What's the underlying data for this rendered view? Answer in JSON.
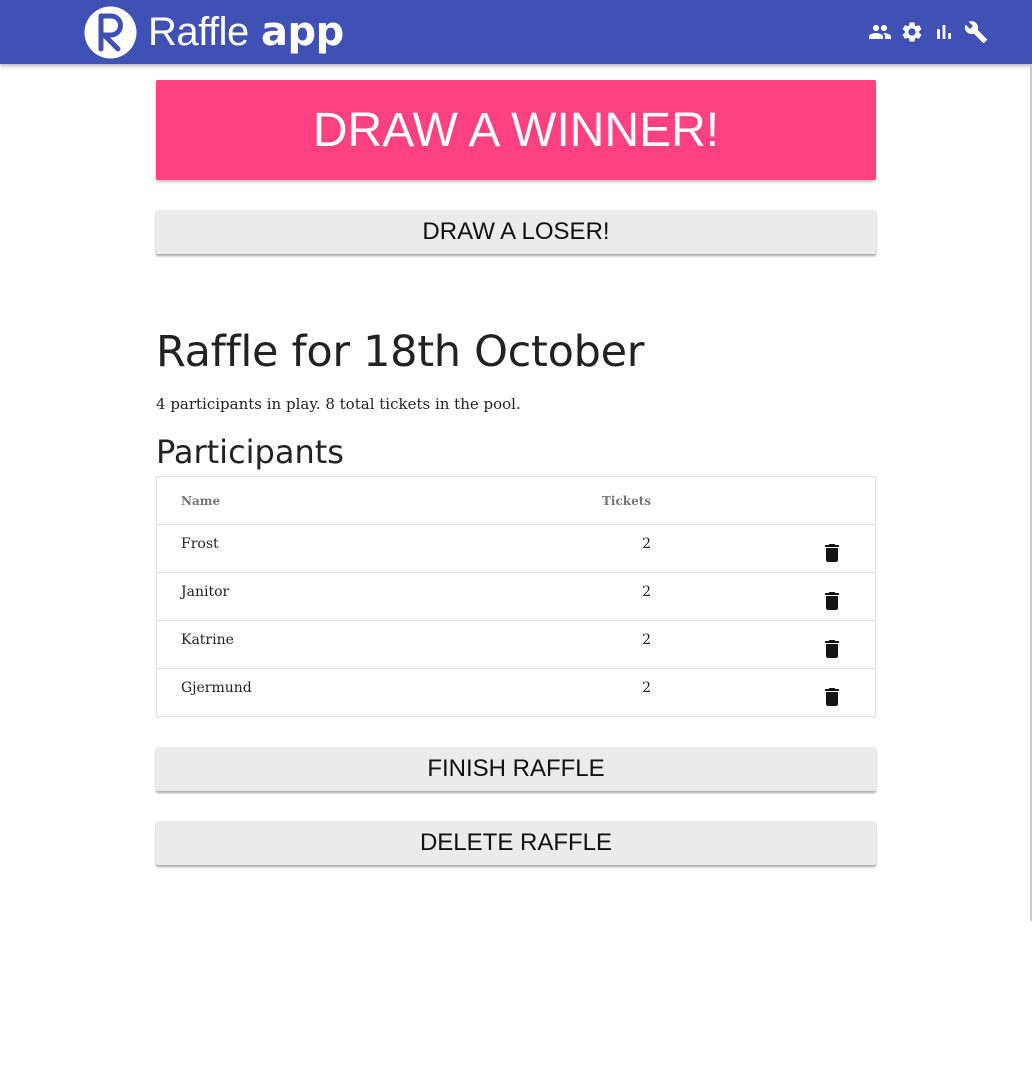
{
  "app": {
    "logo_light": "Raffle",
    "logo_bold": "app",
    "actions": [
      {
        "icon": "people-icon",
        "label": "Participants"
      },
      {
        "icon": "gear-icon",
        "label": "Settings"
      },
      {
        "icon": "bar-chart-icon",
        "label": "Statistics"
      },
      {
        "icon": "wrench-icon",
        "label": "Tools"
      }
    ]
  },
  "buttons": {
    "draw_winner": "DRAW A WINNER!",
    "draw_loser": "DRAW A LOSER!",
    "finish": "FINISH RAFFLE",
    "delete": "DELETE RAFFLE"
  },
  "raffle": {
    "title": "Raffle for 18th October",
    "participant_count": "4",
    "participants_text": " participants in play. ",
    "ticket_count": "8",
    "tickets_text": " total tickets in the pool."
  },
  "participants": {
    "heading": "Participants",
    "columns": {
      "name": "Name",
      "tickets": "Tickets"
    },
    "rows": [
      {
        "name": "Frost",
        "tickets": "2"
      },
      {
        "name": "Janitor",
        "tickets": "2"
      },
      {
        "name": "Katrine",
        "tickets": "2"
      },
      {
        "name": "Gjermund",
        "tickets": "2"
      }
    ]
  },
  "colors": {
    "appbar": "#3f51b5",
    "accent": "#ff4081",
    "secondary_button": "#ebebeb"
  }
}
